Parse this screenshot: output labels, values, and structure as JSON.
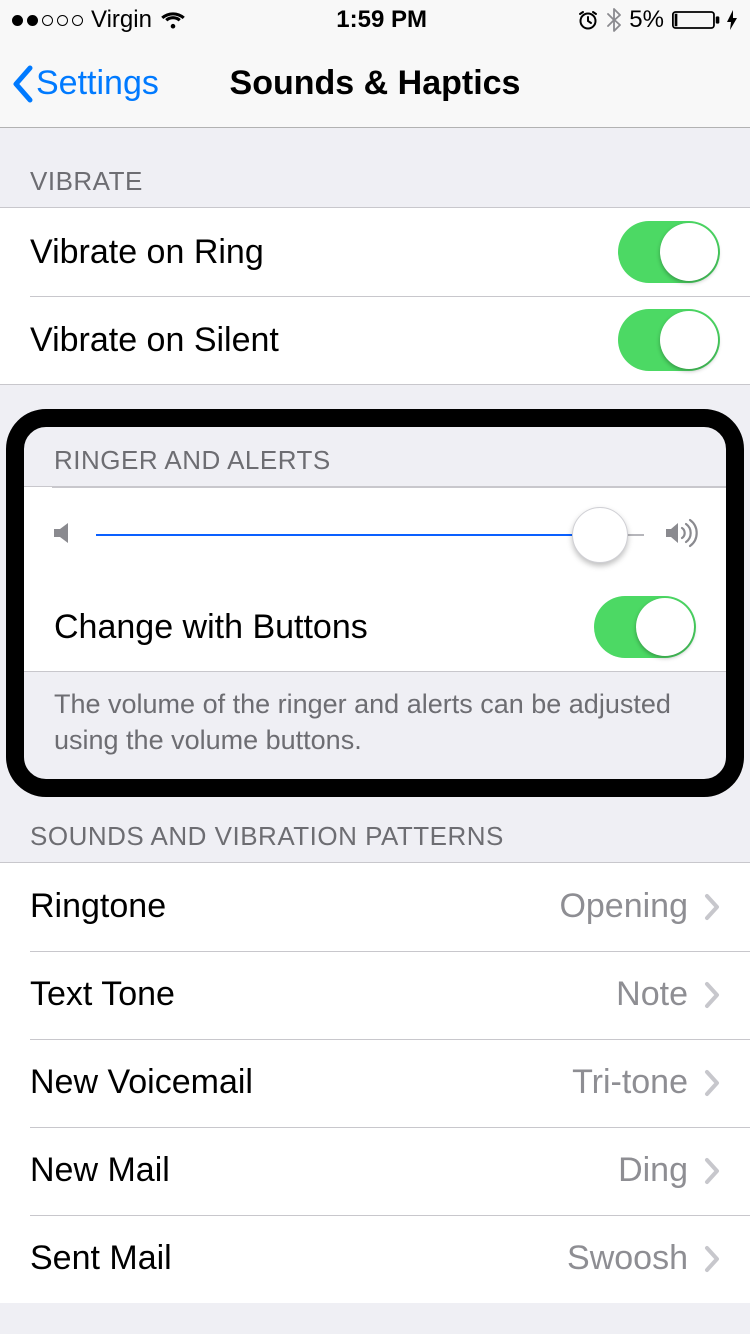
{
  "status": {
    "carrier": "Virgin",
    "time": "1:59 PM",
    "battery_pct": "5%"
  },
  "nav": {
    "back_label": "Settings",
    "title": "Sounds & Haptics"
  },
  "vibrate": {
    "header": "VIBRATE",
    "rows": [
      {
        "label": "Vibrate on Ring",
        "on": true
      },
      {
        "label": "Vibrate on Silent",
        "on": true
      }
    ]
  },
  "ringer": {
    "header": "RINGER AND ALERTS",
    "slider_value_pct": 92,
    "change_label": "Change with Buttons",
    "change_on": true,
    "footer": "The volume of the ringer and alerts can be adjusted using the volume buttons."
  },
  "sounds": {
    "header": "SOUNDS AND VIBRATION PATTERNS",
    "rows": [
      {
        "label": "Ringtone",
        "value": "Opening"
      },
      {
        "label": "Text Tone",
        "value": "Note"
      },
      {
        "label": "New Voicemail",
        "value": "Tri-tone"
      },
      {
        "label": "New Mail",
        "value": "Ding"
      },
      {
        "label": "Sent Mail",
        "value": "Swoosh"
      }
    ]
  }
}
